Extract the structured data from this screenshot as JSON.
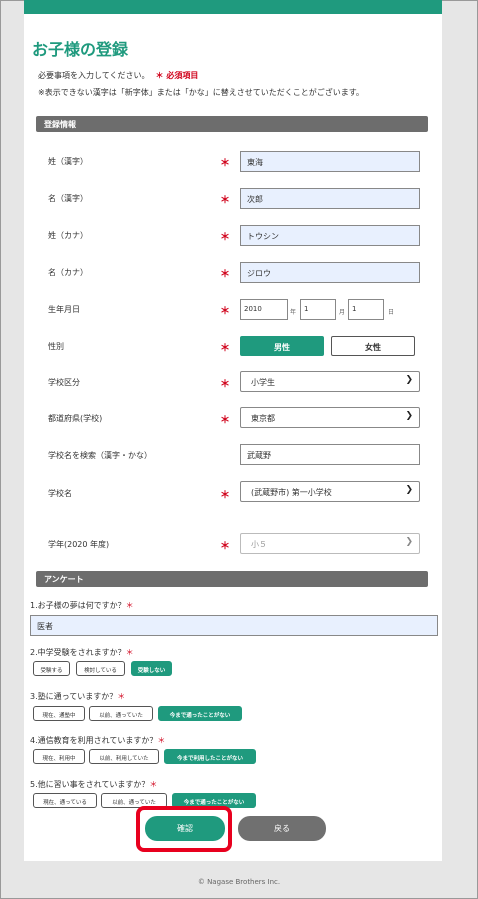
{
  "page": {
    "title": "お子様の登録"
  },
  "notes": {
    "line1": "必要事項を入力してください。",
    "required": "＊ 必須項目",
    "line2": "※表示できない漢字は「新字体」または「かな」に替えさせていただくことがございます。"
  },
  "sections": {
    "registration": "登録情報",
    "survey": "アンケート"
  },
  "form": {
    "required_mark": "＊",
    "last_name_kanji": {
      "label": "姓（漢字）",
      "value": "東海"
    },
    "first_name_kanji": {
      "label": "名（漢字）",
      "value": "次郎"
    },
    "last_name_kana": {
      "label": "姓（カナ）",
      "value": "トウシン"
    },
    "first_name_kana": {
      "label": "名（カナ）",
      "value": "ジロウ"
    },
    "birthdate": {
      "label": "生年月日",
      "year": "2010",
      "year_unit": "年",
      "month": "1",
      "month_unit": "月",
      "day": "1",
      "day_unit": "日"
    },
    "gender": {
      "label": "性別",
      "male": "男性",
      "female": "女性"
    },
    "school_type": {
      "label": "学校区分",
      "value": "小学生"
    },
    "prefecture": {
      "label": "都道府県(学校)",
      "value": "東京都"
    },
    "school_search": {
      "label": "学校名を検索（漢字・かな）",
      "value": "武蔵野"
    },
    "school_name": {
      "label": "学校名",
      "value": "(武蔵野市) 第一小学校"
    },
    "grade": {
      "label": "学年(2020 年度)",
      "value": "小５"
    }
  },
  "survey": {
    "q1": {
      "text": "1.お子様の夢は何ですか？",
      "answer": "医者"
    },
    "q2": {
      "text": "2.中学受験をされますか？",
      "options": [
        "受験する",
        "検討している",
        "受験しない"
      ]
    },
    "q3": {
      "text": "3.塾に通っていますか？",
      "options": [
        "現在、通塾中",
        "以前、通っていた",
        "今まで通ったことがない"
      ]
    },
    "q4": {
      "text": "4.通信教育を利用されていますか？",
      "options": [
        "現在、利用中",
        "以前、利用していた",
        "今まで利用したことがない"
      ]
    },
    "q5": {
      "text": "5.他に習い事をされていますか？",
      "options": [
        "現在、通っている",
        "以前、通っていた",
        "今まで通ったことがない"
      ]
    }
  },
  "buttons": {
    "confirm": "確認",
    "back": "戻る"
  },
  "footer": "© Nagase Brothers Inc.",
  "colors": {
    "accent": "#1f9a7e",
    "required": "#d0021b",
    "highlight": "#e8001e"
  }
}
